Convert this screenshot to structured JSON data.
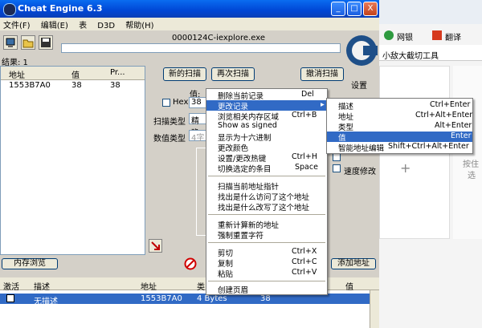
{
  "window": {
    "title": "Cheat Engine 6.3",
    "min_label": "_",
    "max_label": "□",
    "close_label": "X"
  },
  "menubar": [
    "文件(F)",
    "编辑(E)",
    "表",
    "D3D",
    "帮助(H)"
  ],
  "process": {
    "name": "0000124C-iexplore.exe"
  },
  "results": {
    "label": "结果: 1"
  },
  "address_list": {
    "headers": [
      "地址",
      "值",
      "Pr..."
    ],
    "rows": [
      {
        "address": "1553B7A0",
        "value": "38",
        "previous": "38"
      }
    ]
  },
  "scan": {
    "new_scan": "新的扫描",
    "next_scan": "再次扫描",
    "undo_scan": "撤消扫描",
    "settings": "设置",
    "value_label": "值:",
    "value": "38",
    "hex_label": "Hex",
    "scan_type_label": "扫描类型",
    "scan_type_value": "精确",
    "value_type_label": "数值类型",
    "value_type_value": "4字",
    "memory_view": "内存浏览",
    "add_address": "添加地址",
    "stop_speed_label": "速度修改",
    "logo_text": "Cheat Engine"
  },
  "context_menu": {
    "items": [
      {
        "label": "删除当前记录",
        "shortcut": "Del"
      },
      {
        "label": "更改记录",
        "shortcut": "",
        "submenu": true
      },
      {
        "label": "浏览相关内存区域",
        "shortcut": "Ctrl+B"
      },
      {
        "label": "Show as signed",
        "shortcut": ""
      },
      {
        "label": "显示为十六进制",
        "shortcut": ""
      },
      {
        "label": "更改颜色",
        "shortcut": ""
      },
      {
        "label": "设置/更改热键",
        "shortcut": "Ctrl+H"
      },
      {
        "label": "切换选定的条目",
        "shortcut": "Space"
      },
      {
        "label": "扫描当前地址指针",
        "shortcut": ""
      },
      {
        "label": "找出是什么访问了这个地址",
        "shortcut": ""
      },
      {
        "label": "找出是什么改写了这个地址",
        "shortcut": ""
      },
      {
        "label": "重新计算新的地址",
        "shortcut": ""
      },
      {
        "label": "强制重置字符",
        "shortcut": ""
      },
      {
        "label": "剪切",
        "shortcut": "Ctrl+X"
      },
      {
        "label": "复制",
        "shortcut": "Ctrl+C"
      },
      {
        "label": "粘贴",
        "shortcut": "Ctrl+V"
      },
      {
        "label": "创建页眉",
        "shortcut": ""
      }
    ]
  },
  "submenu": {
    "items": [
      {
        "label": "描述",
        "shortcut": "Ctrl+Enter"
      },
      {
        "label": "地址",
        "shortcut": "Ctrl+Alt+Enter"
      },
      {
        "label": "类型",
        "shortcut": "Alt+Enter"
      },
      {
        "label": "值",
        "shortcut": "Enter"
      },
      {
        "label": "智能地址编辑",
        "shortcut": "Shift+Ctrl+Alt+Enter"
      }
    ]
  },
  "cheat_table": {
    "headers": [
      "激活",
      "描述",
      "地址",
      "类",
      "值"
    ],
    "rows": [
      {
        "description": "无描述",
        "address": "1553B7A0",
        "type": "4 Bytes",
        "value": "38"
      }
    ]
  },
  "browser": {
    "tab1": "网银",
    "tab2": "翻译",
    "tab_title": "小敌大截切工具",
    "side1": "按住",
    "side2": "选"
  }
}
